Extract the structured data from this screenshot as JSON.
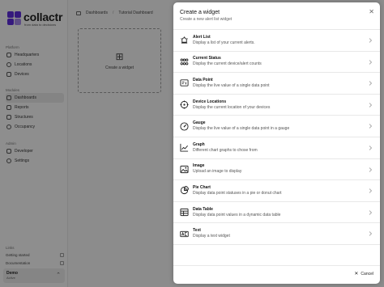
{
  "app": {
    "brand": "collactr",
    "tagline": "from data to decisions",
    "nav_groups": [
      {
        "heading": "Platform",
        "items": [
          {
            "label": "Headquarters",
            "icon": "building-icon"
          },
          {
            "label": "Locations",
            "icon": "map-pin-icon"
          },
          {
            "label": "Devices",
            "icon": "device-icon"
          }
        ]
      },
      {
        "heading": "Modules",
        "items": [
          {
            "label": "Dashboards",
            "icon": "dashboard-icon",
            "active": true
          },
          {
            "label": "Reports",
            "icon": "report-icon"
          },
          {
            "label": "Structures",
            "icon": "structure-icon"
          },
          {
            "label": "Occupancy",
            "icon": "occupancy-icon"
          }
        ]
      },
      {
        "heading": "Admin",
        "items": [
          {
            "label": "Developer",
            "icon": "code-icon"
          },
          {
            "label": "Settings",
            "icon": "gear-icon"
          }
        ]
      }
    ],
    "links_heading": "Links",
    "links": [
      "Getting started",
      "Documentation"
    ],
    "account": {
      "name": "Demo",
      "status": "Active"
    },
    "breadcrumbs": [
      "Dashboards",
      "Tutorial Dashboard"
    ],
    "add_widget_label": "Create a widget"
  },
  "drawer": {
    "title": "Create a widget",
    "subtitle": "Create a new alert list widget",
    "cancel_label": "Cancel",
    "widgets": [
      {
        "title": "Alert List",
        "desc": "Display a list of your current alerts.",
        "icon": "alert-icon"
      },
      {
        "title": "Current Status",
        "desc": "Display the current device/alert counts",
        "icon": "status-dots-icon"
      },
      {
        "title": "Data Point",
        "desc": "Display the live value of a single data point",
        "icon": "data-point-icon"
      },
      {
        "title": "Device Locations",
        "desc": "Display the current location of your devices",
        "icon": "location-icon"
      },
      {
        "title": "Gauge",
        "desc": "Display the live value of a single data point in a gauge",
        "icon": "gauge-icon"
      },
      {
        "title": "Graph",
        "desc": "Different chart graphs to chose from",
        "icon": "graph-icon"
      },
      {
        "title": "Image",
        "desc": "Upload an image to display",
        "icon": "image-icon"
      },
      {
        "title": "Pie Chart",
        "desc": "Display data point statuses in a pie or donut chart",
        "icon": "pie-chart-icon"
      },
      {
        "title": "Data Table",
        "desc": "Display data point values in a dynamic data table",
        "icon": "table-icon"
      },
      {
        "title": "Text",
        "desc": "Display a text widget",
        "icon": "text-icon"
      }
    ]
  }
}
